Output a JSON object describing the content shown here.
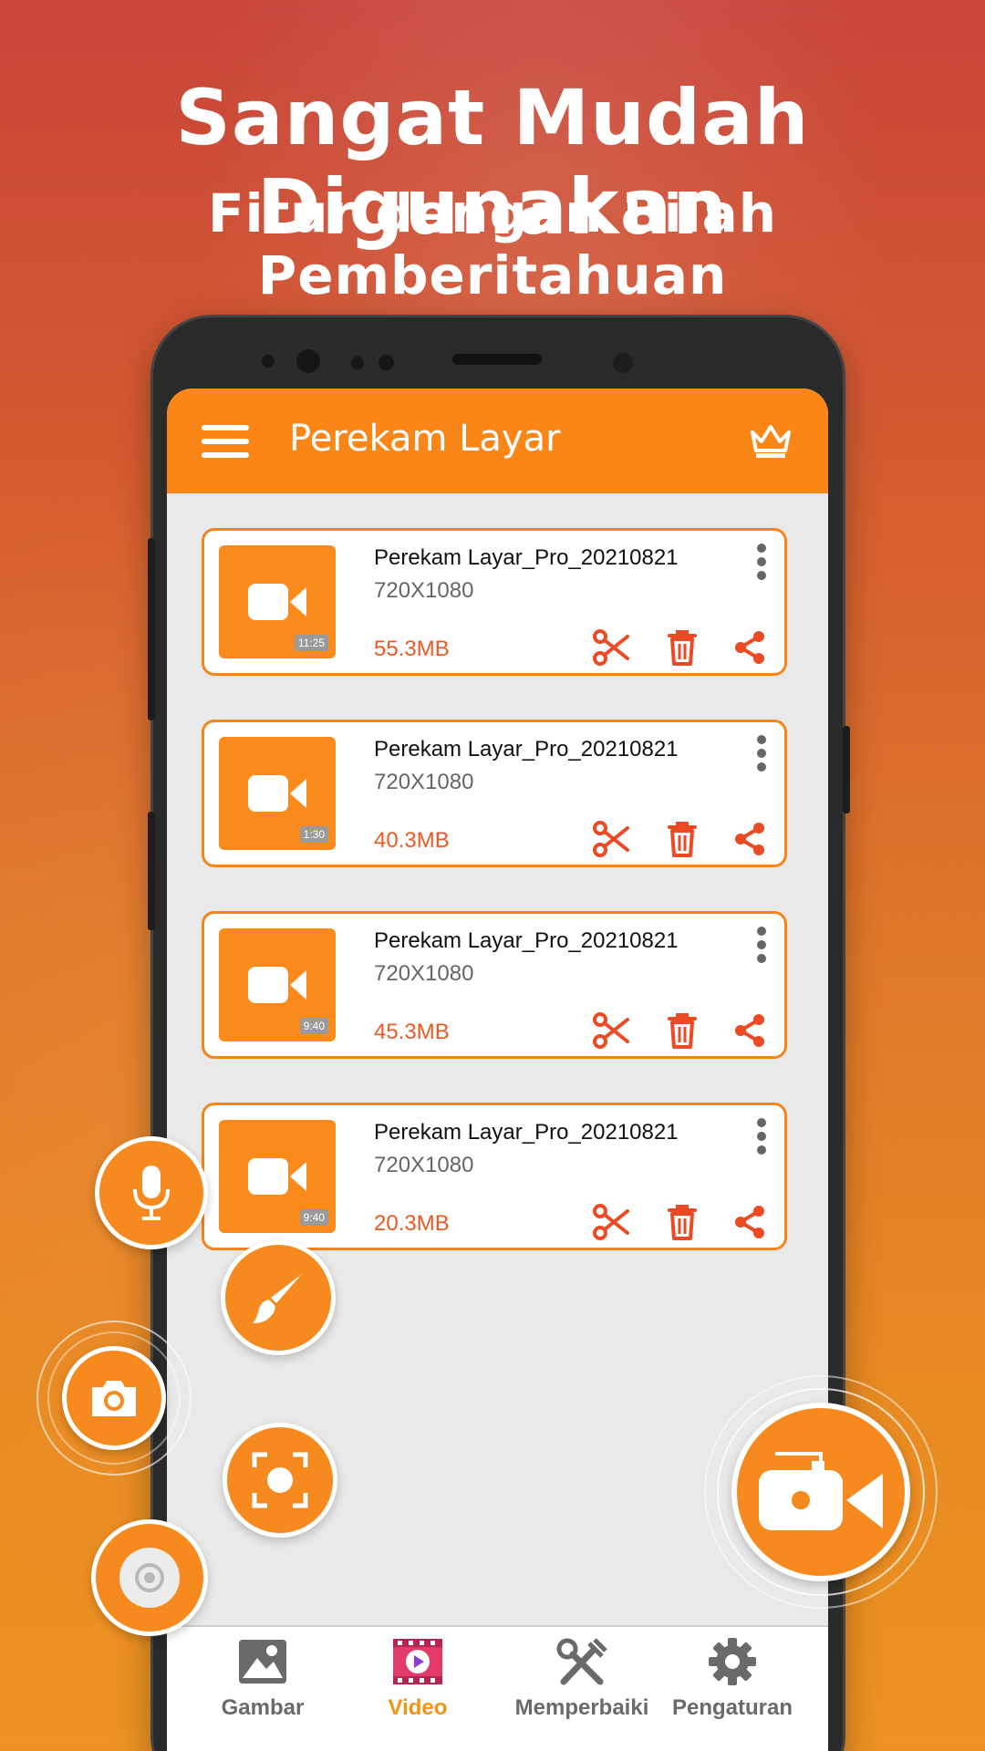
{
  "promo": {
    "headline": "Sangat Mudah Digunakan",
    "subline": "Fitur dengan Bilah Pemberitahuan"
  },
  "app": {
    "title": "Perekam Layar",
    "menu_icon": "hamburger-menu-icon",
    "premium_icon": "crown-icon",
    "accent_color": "#fb8618",
    "size_color": "#ec5a24"
  },
  "videos": [
    {
      "name": "Perekam Layar_Pro_20210821",
      "resolution": "720X1080",
      "size": "55.3MB",
      "duration": "11:25"
    },
    {
      "name": "Perekam Layar_Pro_20210821",
      "resolution": "720X1080",
      "size": "40.3MB",
      "duration": "1:30"
    },
    {
      "name": "Perekam Layar_Pro_20210821",
      "resolution": "720X1080",
      "size": "45.3MB",
      "duration": "9:40"
    },
    {
      "name": "Perekam Layar_Pro_20210821",
      "resolution": "720X1080",
      "size": "20.3MB",
      "duration": "9:40"
    }
  ],
  "card_actions": [
    "scissors-icon",
    "trash-icon",
    "share-icon",
    "more-vertical-icon"
  ],
  "floating_tools": [
    "microphone-icon",
    "brush-icon",
    "camera-icon",
    "screenshot-icon",
    "toggle-icon",
    "video-record-icon"
  ],
  "bottom_nav": {
    "items": [
      {
        "label": "Gambar",
        "icon": "image-icon",
        "active": false
      },
      {
        "label": "Video",
        "icon": "video-play-icon",
        "active": true
      },
      {
        "label": "Memperbaiki",
        "icon": "tools-icon",
        "active": false
      },
      {
        "label": "Pengaturan",
        "icon": "gear-icon",
        "active": false
      }
    ],
    "active_color": "#f29318"
  }
}
